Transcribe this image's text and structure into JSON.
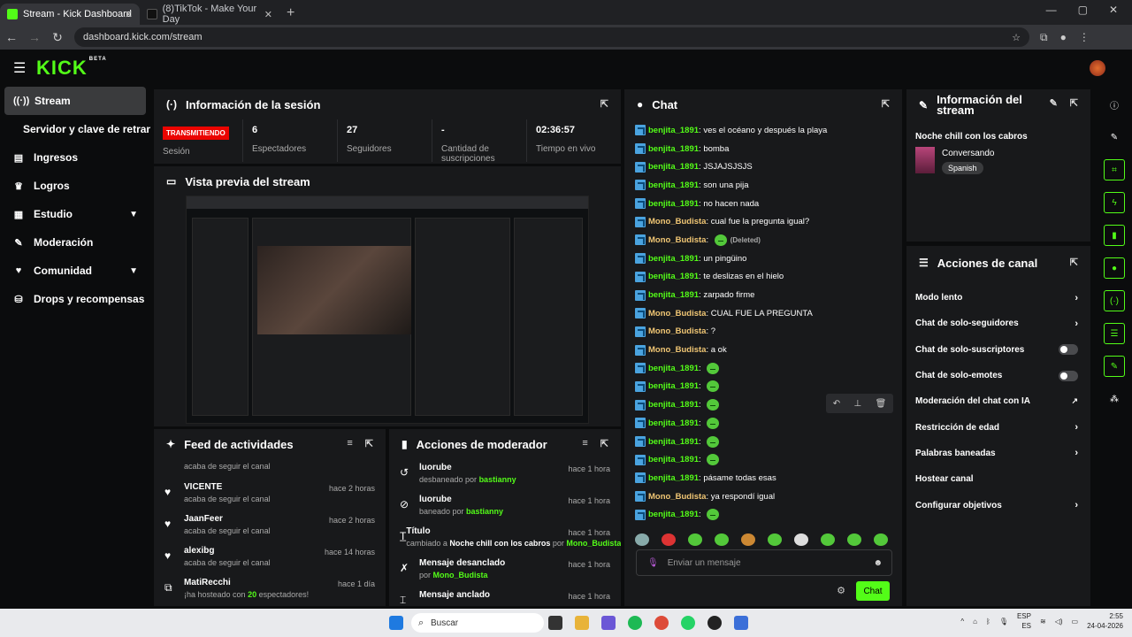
{
  "browser": {
    "tabs": [
      {
        "title": "Stream - Kick Dashboard",
        "active": true
      },
      {
        "title": "(8)TikTok - Make Your Day",
        "active": false
      }
    ],
    "url": "dashboard.kick.com/stream"
  },
  "brand": {
    "logo": "KICK",
    "beta": "BETA",
    "accent": "#53fc18"
  },
  "sidebar": {
    "items": [
      {
        "label": "Stream",
        "icon": "broadcast-icon",
        "active": true
      },
      {
        "label": "Servidor y clave de retransmisión",
        "sub": true
      },
      {
        "label": "Ingresos",
        "icon": "wallet-icon"
      },
      {
        "label": "Logros",
        "icon": "trophy-icon"
      },
      {
        "label": "Estudio",
        "icon": "studio-icon",
        "chevron": true
      },
      {
        "label": "Moderación",
        "icon": "wrench-icon"
      },
      {
        "label": "Comunidad",
        "icon": "community-icon",
        "chevron": true
      },
      {
        "label": "Drops y recompensas",
        "icon": "gift-icon"
      }
    ]
  },
  "session": {
    "title": "Información de la sesión",
    "stats": [
      {
        "value": "TRANSMITIENDO",
        "label": "Sesión"
      },
      {
        "value": "6",
        "label": "Espectadores"
      },
      {
        "value": "27",
        "label": "Seguidores"
      },
      {
        "value": "-",
        "label": "Cantidad de suscripciones"
      },
      {
        "value": "02:36:57",
        "label": "Tiempo en vivo"
      }
    ]
  },
  "preview": {
    "title": "Vista previa del stream"
  },
  "activity": {
    "title": "Feed de actividades",
    "items": [
      {
        "name": "",
        "sub": "acaba de seguir el canal",
        "time": ""
      },
      {
        "name": "VICENTE",
        "sub": "acaba de seguir el canal",
        "time": "hace 2 horas"
      },
      {
        "name": "JaanFeer",
        "sub": "acaba de seguir el canal",
        "time": "hace 2 horas"
      },
      {
        "name": "alexibg",
        "sub": "acaba de seguir el canal",
        "time": "hace 14 horas"
      },
      {
        "name": "MatiRecchi",
        "sub_pre": "¡ha hosteado con ",
        "sub_count": "20",
        "sub_post": " espectadores!",
        "time": "hace 1 día"
      }
    ]
  },
  "modactions": {
    "title": "Acciones de moderador",
    "items": [
      {
        "name": "luorube",
        "sub_pre": "desbaneado por ",
        "by": "bastianny",
        "time": "hace 1 hora",
        "icon": "undo-icon"
      },
      {
        "name": "luorube",
        "sub_pre": "baneado por ",
        "by": "bastianny",
        "time": "hace 1 hora",
        "icon": "ban-icon"
      },
      {
        "name": "Título",
        "sub_pre": "cambiado a ",
        "bold": "Noche chill con los cabros",
        "mid": " por ",
        "by": "Mono_Budista",
        "time": "hace 1 hora",
        "icon": "title-icon"
      },
      {
        "name": "Mensaje desanclado",
        "sub_pre": "por ",
        "by": "Mono_Budista",
        "time": "hace 1 hora",
        "icon": "unpin-icon"
      },
      {
        "name": "Mensaje anclado",
        "time": "hace 1 hora",
        "icon": "pin-icon"
      }
    ]
  },
  "chat": {
    "title": "Chat",
    "messages": [
      {
        "user": "benjita_1891",
        "c": "g",
        "text": "ves el océano y después la playa"
      },
      {
        "user": "benjita_1891",
        "c": "g",
        "text": "bomba"
      },
      {
        "user": "benjita_1891",
        "c": "g",
        "text": "JSJAJSJSJS"
      },
      {
        "user": "benjita_1891",
        "c": "g",
        "text": "son una pija"
      },
      {
        "user": "benjita_1891",
        "c": "g",
        "text": "no hacen nada"
      },
      {
        "user": "Mono_Budista",
        "c": "o",
        "text": "cual fue la pregunta igual?"
      },
      {
        "user": "Mono_Budista",
        "c": "o",
        "text": "",
        "emote": true,
        "deleted": "(Deleted)"
      },
      {
        "user": "benjita_1891",
        "c": "g",
        "text": "un pingüino"
      },
      {
        "user": "benjita_1891",
        "c": "g",
        "text": "te deslizas en el hielo"
      },
      {
        "user": "benjita_1891",
        "c": "g",
        "text": "zarpado firme"
      },
      {
        "user": "Mono_Budista",
        "c": "o",
        "text": "CUAL FUE LA PREGUNTA"
      },
      {
        "user": "Mono_Budista",
        "c": "o",
        "text": "?"
      },
      {
        "user": "Mono_Budista",
        "c": "o",
        "text": "a ok"
      },
      {
        "user": "benjita_1891",
        "c": "g",
        "text": "",
        "emote": true
      },
      {
        "user": "benjita_1891",
        "c": "g",
        "text": "",
        "emote": true
      },
      {
        "user": "benjita_1891",
        "c": "g",
        "text": "",
        "emote": true
      },
      {
        "user": "benjita_1891",
        "c": "g",
        "text": "",
        "emote": true
      },
      {
        "user": "benjita_1891",
        "c": "g",
        "text": "",
        "emote": true
      },
      {
        "user": "benjita_1891",
        "c": "g",
        "text": "",
        "emote": true
      },
      {
        "user": "benjita_1891",
        "c": "g",
        "text": "pásame todas esas"
      },
      {
        "user": "Mono_Budista",
        "c": "o",
        "text": "ya respondí igual"
      },
      {
        "user": "benjita_1891",
        "c": "g",
        "text": "",
        "emote": true
      }
    ],
    "placeholder": "Enviar un mensaje",
    "send_label": "Chat"
  },
  "stream_info": {
    "title": "Información del stream",
    "stream_title": "Noche chill con los cabros",
    "category": "Conversando",
    "tag": "Spanish"
  },
  "channel_actions": {
    "title": "Acciones de canal",
    "items": [
      {
        "label": "Modo lento",
        "type": "chevron"
      },
      {
        "label": "Chat de solo-seguidores",
        "type": "chevron"
      },
      {
        "label": "Chat de solo-suscriptores",
        "type": "toggle"
      },
      {
        "label": "Chat de solo-emotes",
        "type": "toggle"
      },
      {
        "label": "Moderación del chat con IA",
        "type": "external"
      },
      {
        "label": "Restricción de edad",
        "type": "chevron"
      },
      {
        "label": "Palabras baneadas",
        "type": "chevron"
      },
      {
        "label": "Hostear canal",
        "type": "none"
      },
      {
        "label": "Configurar objetivos",
        "type": "chevron"
      }
    ]
  },
  "taskbar": {
    "search": "Buscar",
    "lang": "ESP",
    "lang2": "ES",
    "time": "2:55",
    "date": "24-04-2026"
  }
}
